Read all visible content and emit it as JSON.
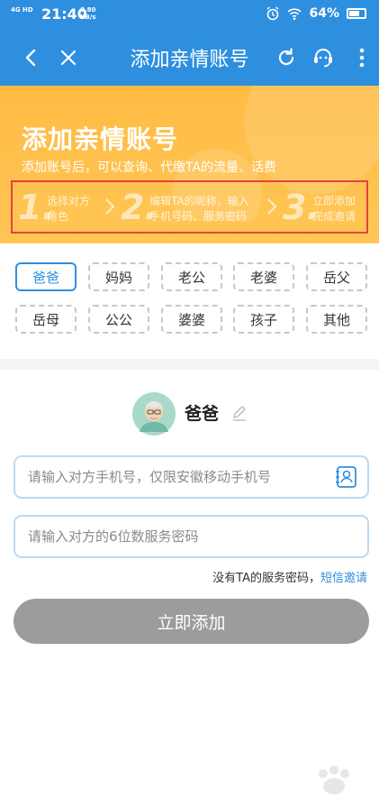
{
  "status_bar": {
    "network": "4G HD",
    "time": "21:40",
    "speed_value": "0.80",
    "speed_unit": "KB/s",
    "battery": "64%"
  },
  "title_bar": {
    "title": "添加亲情账号",
    "icons": [
      "back-icon",
      "close-icon",
      "refresh-icon",
      "customer-service-icon",
      "more-icon"
    ]
  },
  "banner": {
    "title": "添加亲情账号",
    "subtitle": "添加账号后，可以查询、代缴TA的流量、话费",
    "steps": [
      {
        "num": "1.",
        "line1": "选择对方",
        "line2": "角色"
      },
      {
        "num": "2.",
        "line1": "编辑TA的昵称，输入",
        "line2": "手机号码、服务密码"
      },
      {
        "num": "3.",
        "line1": "立即添加",
        "line2": "完成邀请"
      }
    ]
  },
  "relations": {
    "selected": "爸爸",
    "items": [
      "爸爸",
      "妈妈",
      "老公",
      "老婆",
      "岳父",
      "岳母",
      "公公",
      "婆婆",
      "孩子",
      "其他"
    ]
  },
  "profile": {
    "name": "爸爸"
  },
  "form": {
    "phone_placeholder": "请输入对方手机号，仅限安徽移动手机号",
    "password_placeholder": "请输入对方的6位数服务密码",
    "hint_text": "没有TA的服务密码，",
    "hint_link": "短信邀请",
    "submit_label": "立即添加"
  },
  "colors": {
    "primary": "#2f8fdf",
    "banner": "#ffbb44",
    "button_disabled": "#9c9c9c",
    "highlight_border": "#e94040"
  }
}
